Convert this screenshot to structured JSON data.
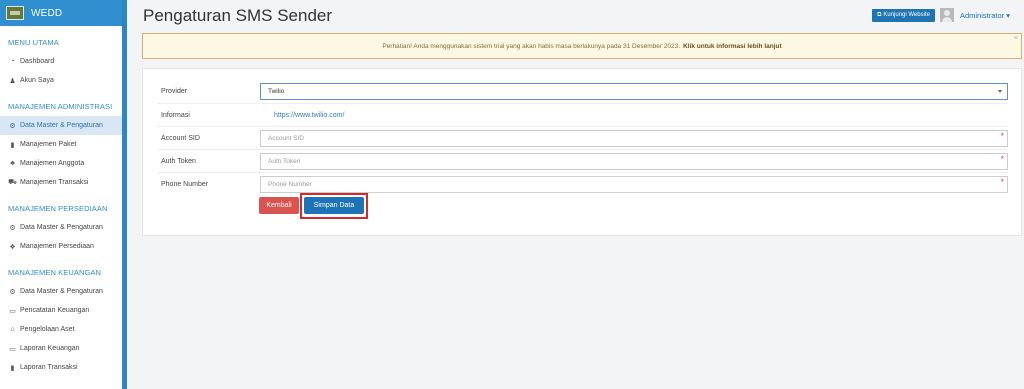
{
  "brand": {
    "name": "WEDD"
  },
  "sidebar": {
    "groups": [
      {
        "title": "MENU UTAMA",
        "items": [
          {
            "label": "Dashboard",
            "icon": "dashboard-icon"
          },
          {
            "label": "Akun Saya",
            "icon": "user-icon"
          }
        ]
      },
      {
        "title": "MANAJEMEN ADMINISTRASI",
        "items": [
          {
            "label": "Data Master & Pengaturan",
            "icon": "gears-icon",
            "active": true
          },
          {
            "label": "Manajemen Paket",
            "icon": "book-icon"
          },
          {
            "label": "Manajemen Anggota",
            "icon": "users-icon"
          },
          {
            "label": "Manajemen Transaksi",
            "icon": "cart-icon"
          }
        ]
      },
      {
        "title": "MANAJEMEN PERSEDIAAN",
        "items": [
          {
            "label": "Data Master & Pengaturan",
            "icon": "gears-icon"
          },
          {
            "label": "Manajemen Persediaan",
            "icon": "cubes-icon"
          }
        ]
      },
      {
        "title": "MANAJEMEN KEUANGAN",
        "items": [
          {
            "label": "Data Master & Pengaturan",
            "icon": "gears-icon"
          },
          {
            "label": "Pencatatan Keuangan",
            "icon": "money-icon"
          },
          {
            "label": "Pengelolaan Aset",
            "icon": "hdd-icon"
          },
          {
            "label": "Laporan Keuangan",
            "icon": "money-icon"
          },
          {
            "label": "Laporan Transaksi",
            "icon": "book-icon"
          }
        ]
      }
    ]
  },
  "header": {
    "title": "Pengaturan SMS Sender",
    "visit_label": "Kunjungi Website",
    "user_label": "Administrator"
  },
  "alert": {
    "text": "Perhatian! Anda menggunakan sistem trial yang akan habis masa berlakunya pada 31 Desember 2023.",
    "link": "Klik untuk informasi lebih lanjut",
    "close": "×"
  },
  "form": {
    "provider": {
      "label": "Provider",
      "value": "Twilio"
    },
    "info": {
      "label": "Informasi",
      "value": "https://www.twilio.com/"
    },
    "account_sid": {
      "label": "Account SID",
      "placeholder": "Account SID"
    },
    "auth_token": {
      "label": "Auth Token",
      "placeholder": "Auth Token"
    },
    "phone": {
      "label": "Phone Number",
      "placeholder": "Phone Number"
    },
    "required_mark": "*"
  },
  "buttons": {
    "back": "Kembali",
    "save": "Simpan Data"
  },
  "colors": {
    "accent": "#2f8fcf",
    "primary": "#1e73b6",
    "danger": "#d9534f",
    "alert_bg": "#fcf8e3"
  }
}
